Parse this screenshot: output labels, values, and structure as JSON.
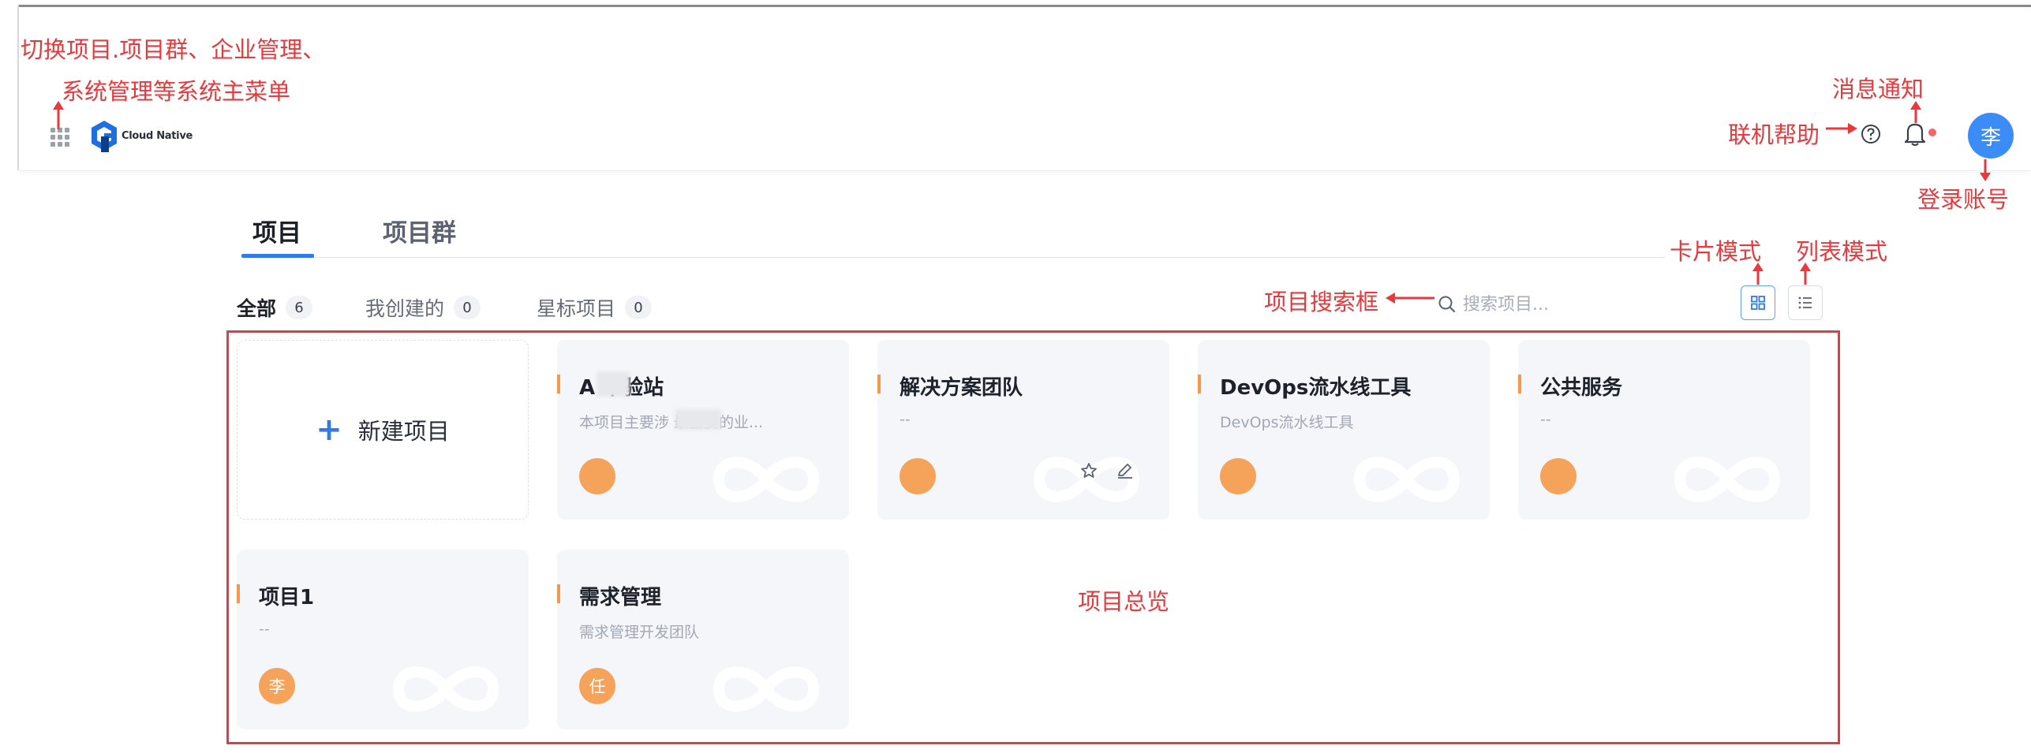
{
  "annotations": {
    "switch_menu_line1": "切换项目.项目群、企业管理、",
    "switch_menu_line2": "系统管理等系统主菜单",
    "notifications": "消息通知",
    "help": "联机帮助",
    "login_account": "登录账号",
    "card_mode": "卡片模式",
    "list_mode": "列表模式",
    "search_box": "项目搜索框",
    "overview": "项目总览"
  },
  "header": {
    "logo_text": "Cloud Native",
    "avatar_text": "李"
  },
  "tabs": [
    {
      "label": "项目",
      "active": true
    },
    {
      "label": "项目群",
      "active": false
    }
  ],
  "filters": [
    {
      "label": "全部",
      "count": "6",
      "active": true
    },
    {
      "label": "我创建的",
      "count": "0",
      "active": false
    },
    {
      "label": "星标项目",
      "count": "0",
      "active": false
    }
  ],
  "search": {
    "placeholder": "搜索项目..."
  },
  "new_project": {
    "label": "新建项目"
  },
  "cards": [
    {
      "name": "A     本验站",
      "desc": "本项目主要涉      最主要的业...",
      "member": ""
    },
    {
      "name": "解决方案团队",
      "desc": "--",
      "member": ""
    },
    {
      "name": "DevOps流水线工具",
      "desc": "DevOps流水线工具",
      "member": ""
    },
    {
      "name": "公共服务",
      "desc": "--",
      "member": ""
    },
    {
      "name": "项目1",
      "desc": "--",
      "member": "李"
    },
    {
      "name": "需求管理",
      "desc": "需求管理开发团队",
      "member": "任"
    }
  ],
  "colors": {
    "accent_blue": "#2f7bea",
    "annotation_red": "#e8393e",
    "card_accent": "#f39a4a",
    "avatar_blue": "#3b8cf6",
    "member_orange": "#f5a35a"
  }
}
